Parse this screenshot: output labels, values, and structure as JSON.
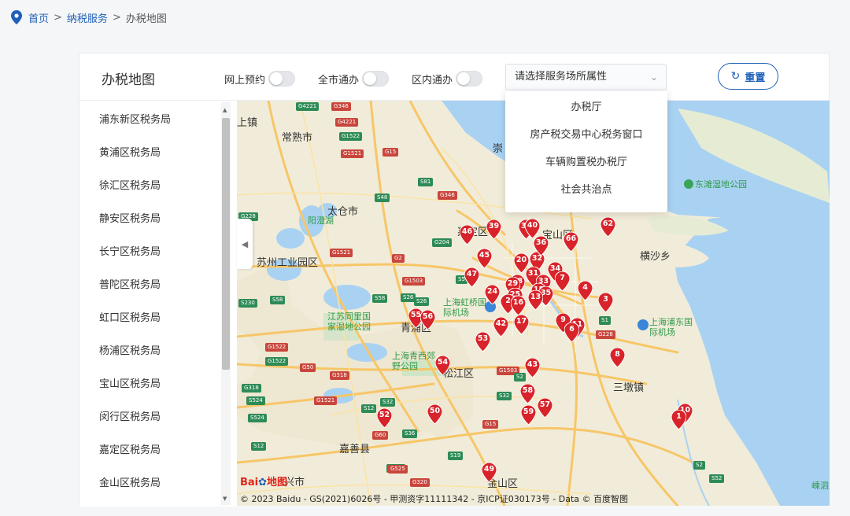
{
  "breadcrumb": {
    "home": "首页",
    "sep": ">",
    "service": "纳税服务",
    "current": "办税地图"
  },
  "header": {
    "title": "办税地图",
    "toggles": [
      {
        "label": "网上预约",
        "on": false
      },
      {
        "label": "全市通办",
        "on": false
      },
      {
        "label": "区内通办",
        "on": false
      }
    ],
    "select_placeholder": "请选择服务场所属性",
    "select_arrow": "⌄",
    "reset_icon": "↻",
    "reset_label": "重置"
  },
  "dropdown": [
    "办税厅",
    "房产税交易中心税务窗口",
    "车辆购置税办税厅",
    "社会共治点"
  ],
  "districts": [
    "浦东新区税务局",
    "黄浦区税务局",
    "徐汇区税务局",
    "静安区税务局",
    "长宁区税务局",
    "普陀区税务局",
    "虹口区税务局",
    "杨浦区税务局",
    "宝山区税务局",
    "闵行区税务局",
    "嘉定区税务局",
    "金山区税务局"
  ],
  "map": {
    "copyright": "© 2023 Baidu - GS(2021)6026号 - 甲测资字11111342 - 京ICP证030173号 - Data © 百度智图",
    "logo": {
      "part1": "Bai",
      "part2": "地图"
    },
    "places": [
      "常熟市",
      "太仓市",
      "嘉定区",
      "苏州工业园区",
      "青浦区",
      "松江区",
      "嘉善县",
      "金山区",
      "横沙乡",
      "三墩镇",
      "宝山区",
      "兴市",
      "上镇",
      "崇"
    ],
    "parks": [
      "阳澄湖",
      "东滩湿地公园",
      "江苏同里国家湿地公园",
      "上海青西郊野公园",
      "上海虹桥国际机场",
      "上海浦东国际机场",
      "嵊泗风景名"
    ],
    "roads": [
      "G4221",
      "G346",
      "G4221",
      "G1522",
      "G1521",
      "G15",
      "S48",
      "S81",
      "G346",
      "G228",
      "G1521",
      "G2",
      "G204",
      "S5",
      "G1503",
      "S58",
      "S230",
      "S58",
      "S26",
      "S26",
      "G1522",
      "G1522",
      "G50",
      "G318",
      "G318",
      "S524",
      "S524",
      "S12",
      "G1521",
      "S32",
      "S12",
      "G60",
      "S36",
      "S19",
      "G15",
      "G1503",
      "S2",
      "G228",
      "S1",
      "S2",
      "S52",
      "G320",
      "S125",
      "G525",
      "S32"
    ],
    "markers": [
      "46",
      "39",
      "38",
      "40",
      "66",
      "62",
      "45",
      "20",
      "32",
      "36",
      "31",
      "34",
      "47",
      "28",
      "33",
      "7",
      "24",
      "29",
      "25",
      "15",
      "35",
      "2",
      "16",
      "13",
      "4",
      "3",
      "55",
      "56",
      "42",
      "17",
      "9",
      "11",
      "6",
      "53",
      "8",
      "43",
      "54",
      "58",
      "57",
      "59",
      "52",
      "50",
      "10",
      "1",
      "49"
    ]
  },
  "colors": {
    "accent": "#1f5fb8",
    "marker": "#d8232a",
    "water": "#a9d2f2",
    "land": "#f1ecd9",
    "road": "#f7c668"
  }
}
